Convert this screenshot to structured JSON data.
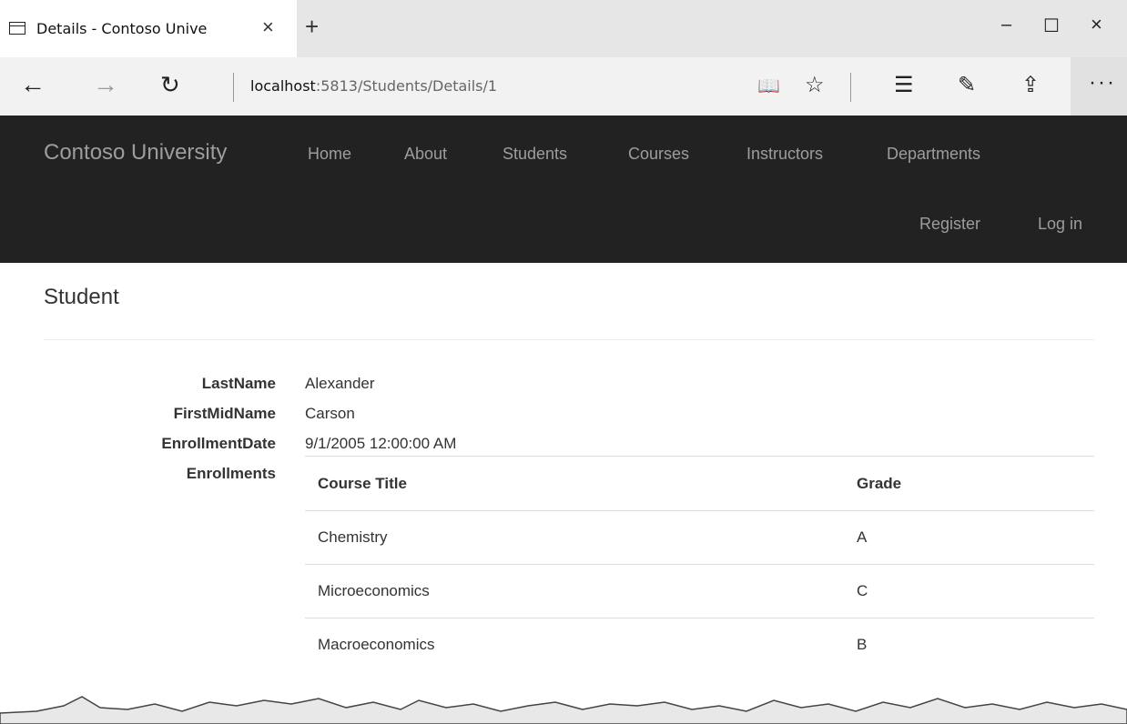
{
  "browser": {
    "tab_title": "Details - Contoso Unive",
    "tab_close": "×",
    "new_tab": "+",
    "window_controls": {
      "minimize": "–",
      "maximize": "☐",
      "close": "×"
    },
    "nav": {
      "back": "←",
      "forward": "→",
      "refresh": "↻"
    },
    "url_host": "localhost",
    "url_rest": ":5813/Students/Details/1",
    "tools": {
      "reading_view": "📖",
      "favorite": "☆",
      "hub": "☰",
      "web_note": "✎",
      "share": "⇪",
      "more": "···"
    }
  },
  "navbar": {
    "brand": "Contoso University",
    "links": [
      "Home",
      "About",
      "Students",
      "Courses",
      "Instructors",
      "Departments"
    ],
    "register": "Register",
    "login": "Log in",
    "colors": {
      "background": "#222222",
      "link": "#9d9d9d"
    }
  },
  "page": {
    "title": "Student",
    "fields": [
      {
        "label": "LastName",
        "value": "Alexander"
      },
      {
        "label": "FirstMidName",
        "value": "Carson"
      },
      {
        "label": "EnrollmentDate",
        "value": "9/1/2005 12:00:00 AM"
      },
      {
        "label": "Enrollments",
        "value": ""
      }
    ],
    "enrollments": {
      "headers": [
        "Course Title",
        "Grade"
      ],
      "rows": [
        [
          "Chemistry",
          "A"
        ],
        [
          "Microeconomics",
          "C"
        ],
        [
          "Macroeconomics",
          "B"
        ]
      ]
    }
  }
}
